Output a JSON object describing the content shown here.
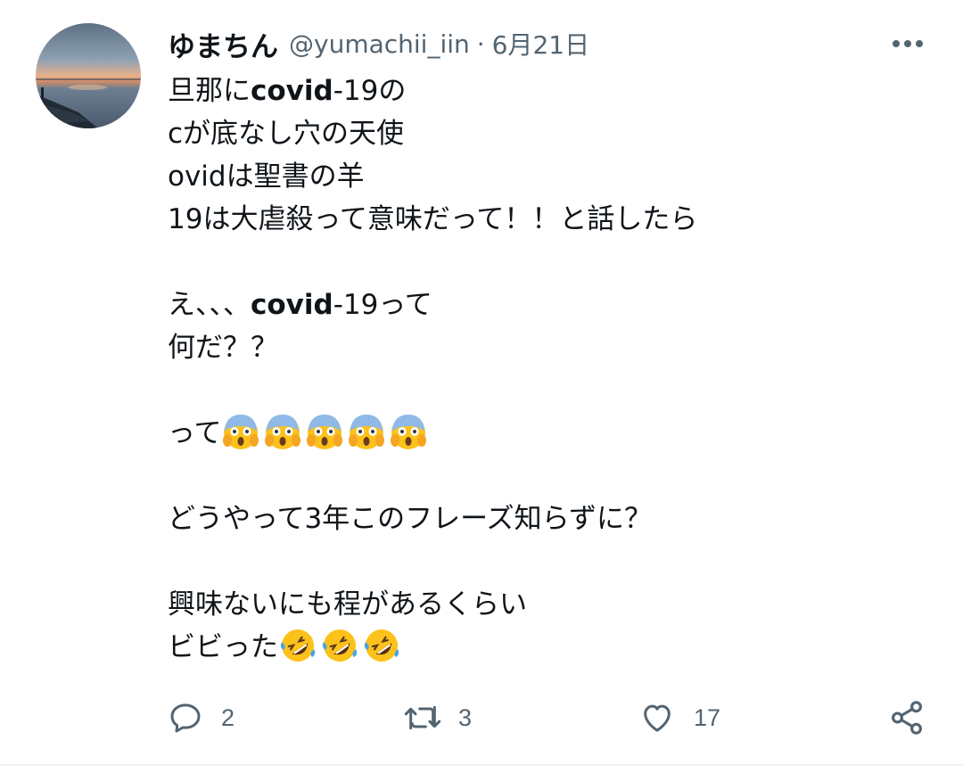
{
  "tweet": {
    "author": {
      "display_name": "ゆまちん",
      "handle": "@yumachii_iin",
      "separator": "·",
      "date": "6月21日"
    },
    "text": {
      "line1_a": "旦那に",
      "line1_tag": "covid",
      "line1_b": "-19の",
      "line2": "cが底なし穴の天使",
      "line3": "ovidは聖書の羊",
      "line4": "19は大虐殺って意味だって！！と話したら",
      "line6_a": "え、、、",
      "line6_tag": "covid",
      "line6_b": "-19って",
      "line7": "何だ？？",
      "line9": "って",
      "line11": "どうやって3年このフレーズ知らずに？",
      "line13": "興味ないにも程があるくらい",
      "line14": "ビビった"
    },
    "emoji": {
      "scream_name": "face-screaming-in-fear",
      "rofl_name": "rolling-on-the-floor-laughing"
    },
    "stats": {
      "replies": "2",
      "retweets": "3",
      "likes": "17"
    }
  },
  "colors": {
    "text": "#0f1419",
    "secondary": "#536471",
    "divider": "#eff3f4"
  }
}
